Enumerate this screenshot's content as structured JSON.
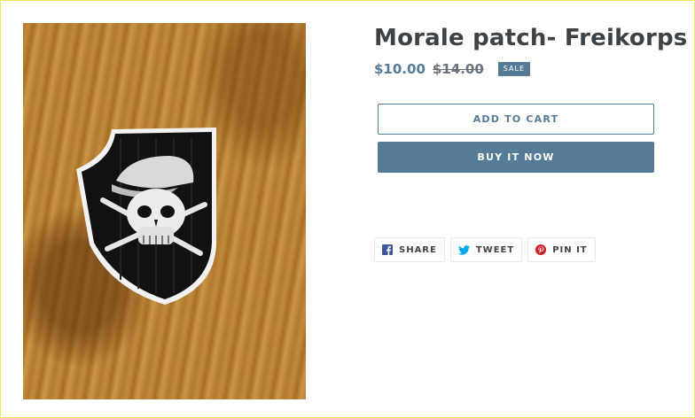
{
  "product": {
    "title": "Morale patch- Freikorps",
    "price": "$10.00",
    "compare_price": "$14.00",
    "sale_badge": "SALE",
    "image_alt": "Morale patch- Freikorps"
  },
  "actions": {
    "add_to_cart": "ADD TO CART",
    "buy_now": "BUY IT NOW"
  },
  "share": [
    {
      "label": "SHARE",
      "icon": "facebook-icon",
      "color": "#3b5998"
    },
    {
      "label": "TWEET",
      "icon": "twitter-icon",
      "color": "#00aced"
    },
    {
      "label": "PIN IT",
      "icon": "pinterest-icon",
      "color": "#cb2027"
    }
  ],
  "colors": {
    "accent": "#557b97",
    "text": "#3d4246",
    "muted": "#69727b"
  }
}
